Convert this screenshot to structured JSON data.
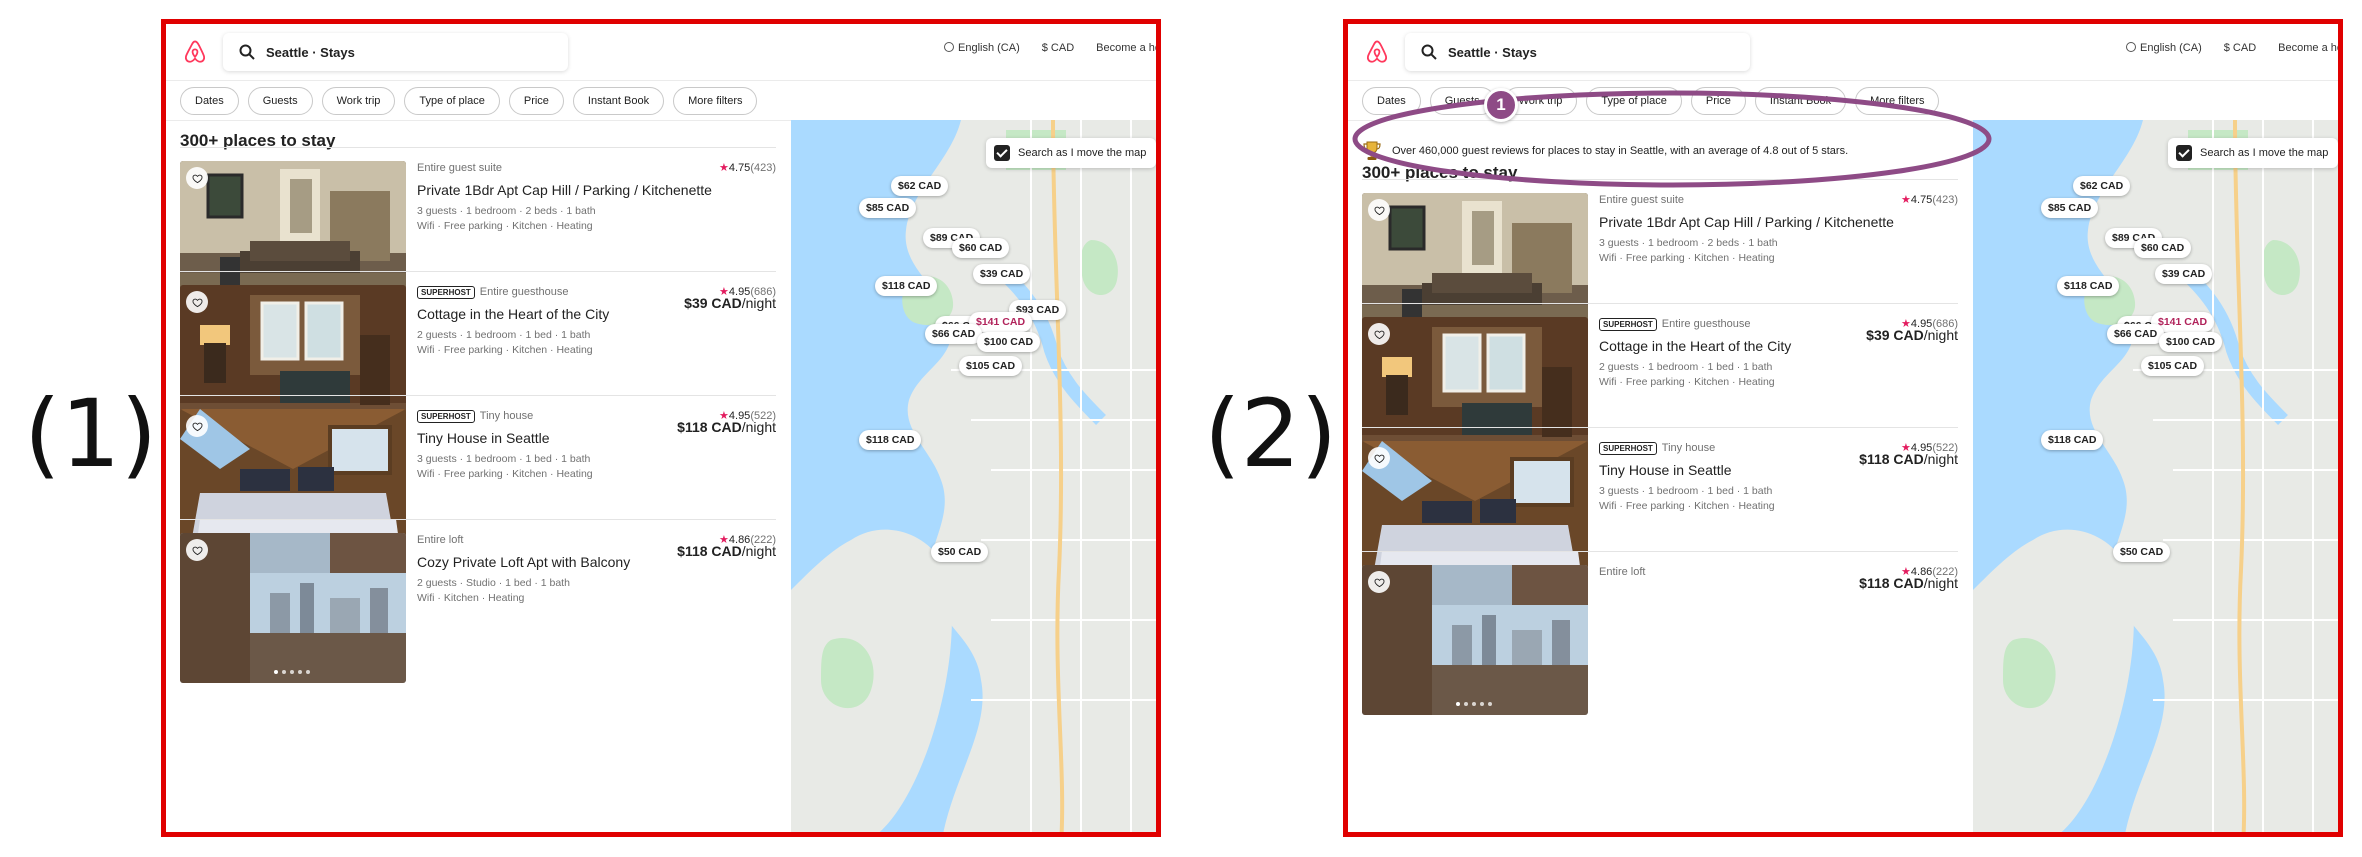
{
  "panels": [
    {
      "label": "(1)",
      "header": {
        "search_text": "Seattle · Stays",
        "language": "English (CA)",
        "currency": "$ CAD",
        "host_link": "Become a host"
      },
      "filters": [
        "Dates",
        "Guests",
        "Work trip",
        "Type of place",
        "Price",
        "Instant Book",
        "More filters"
      ],
      "places_count": "300+ places to stay",
      "listings": [
        {
          "type": "Entire guest suite",
          "superhost": false,
          "superhost_label": "",
          "rating": "4.75",
          "reviews": "(423)",
          "title": "Private 1Bdr Apt Cap Hill / Parking / Kitchenette",
          "details": "3 guests · 1 bedroom · 2 beds · 1 bath",
          "amenities": "Wifi · Free parking · Kitchen · Heating",
          "price": "$39 CAD",
          "per": "/night"
        },
        {
          "type": "Entire guesthouse",
          "superhost": true,
          "superhost_label": "SUPERHOST",
          "rating": "4.95",
          "reviews": "(686)",
          "title": "Cottage in the Heart of the City",
          "details": "2 guests · 1 bedroom · 1 bed · 1 bath",
          "amenities": "Wifi · Free parking · Kitchen · Heating",
          "price": "$118 CAD",
          "per": "/night"
        },
        {
          "type": "Tiny house",
          "superhost": true,
          "superhost_label": "SUPERHOST",
          "rating": "4.95",
          "reviews": "(522)",
          "title": "Tiny House in Seattle",
          "details": "3 guests · 1 bedroom · 1 bed · 1 bath",
          "amenities": "Wifi · Free parking · Kitchen · Heating",
          "price": "$118 CAD",
          "per": "/night"
        },
        {
          "type": "Entire loft",
          "superhost": false,
          "superhost_label": "",
          "rating": "4.86",
          "reviews": "(222)",
          "title": "Cozy Private Loft Apt with Balcony",
          "details": "2 guests · Studio · 1 bed · 1 bath",
          "amenities": "Wifi · Kitchen · Heating",
          "price": "",
          "per": ""
        }
      ],
      "map": {
        "search_toggle": "Search as I move the map",
        "pins": [
          "$62 CAD",
          "$85 CAD",
          "$89 CAD",
          "$60 CAD",
          "$39 CAD",
          "$118 CAD",
          "$93 CAD",
          "$66 CAD",
          "$141 CAD",
          "$66 CAD",
          "$100 CAD",
          "$105 CAD",
          "$118 CAD",
          "$50 CAD"
        ]
      }
    },
    {
      "label": "(2)",
      "header": {
        "search_text": "Seattle · Stays",
        "language": "English (CA)",
        "currency": "$ CAD",
        "host_link": "Become a host"
      },
      "filters": [
        "Dates",
        "Guests",
        "Work trip",
        "Type of place",
        "Price",
        "Instant Book",
        "More filters"
      ],
      "banner": "Over 460,000 guest reviews for places to stay in Seattle, with an average of 4.8 out of 5 stars.",
      "annotation_number": "1",
      "places_count": "300+ places to stay",
      "listings": [
        {
          "type": "Entire guest suite",
          "superhost": false,
          "superhost_label": "",
          "rating": "4.75",
          "reviews": "(423)",
          "title": "Private 1Bdr Apt Cap Hill / Parking / Kitchenette",
          "details": "3 guests · 1 bedroom · 2 beds · 1 bath",
          "amenities": "Wifi · Free parking · Kitchen · Heating",
          "price": "$39 CAD",
          "per": "/night"
        },
        {
          "type": "Entire guesthouse",
          "superhost": true,
          "superhost_label": "SUPERHOST",
          "rating": "4.95",
          "reviews": "(686)",
          "title": "Cottage in the Heart of the City",
          "details": "2 guests · 1 bedroom · 1 bed · 1 bath",
          "amenities": "Wifi · Free parking · Kitchen · Heating",
          "price": "$118 CAD",
          "per": "/night"
        },
        {
          "type": "Tiny house",
          "superhost": true,
          "superhost_label": "SUPERHOST",
          "rating": "4.95",
          "reviews": "(522)",
          "title": "Tiny House in Seattle",
          "details": "3 guests · 1 bedroom · 1 bed · 1 bath",
          "amenities": "Wifi · Free parking · Kitchen · Heating",
          "price": "$118 CAD",
          "per": "/night"
        },
        {
          "type": "Entire loft",
          "superhost": false,
          "superhost_label": "",
          "rating": "4.86",
          "reviews": "(222)",
          "title": "",
          "details": "",
          "amenities": "",
          "price": "",
          "per": ""
        }
      ],
      "map": {
        "search_toggle": "Search as I move the map",
        "pins": [
          "$62 CAD",
          "$85 CAD",
          "$89 CAD",
          "$60 CAD",
          "$39 CAD",
          "$118 CAD",
          "$66 CAD",
          "$141 CAD",
          "$66 CAD",
          "$100 CAD",
          "$105 CAD",
          "$118 CAD",
          "$50 CAD"
        ]
      }
    }
  ],
  "colors": {
    "frame": "#e00000",
    "brand": "#ff385c",
    "star": "#e31c5f",
    "annotation": "#8e4b86",
    "water": "#aadaff",
    "land": "#e8eae6",
    "park": "#c5e8c5"
  }
}
